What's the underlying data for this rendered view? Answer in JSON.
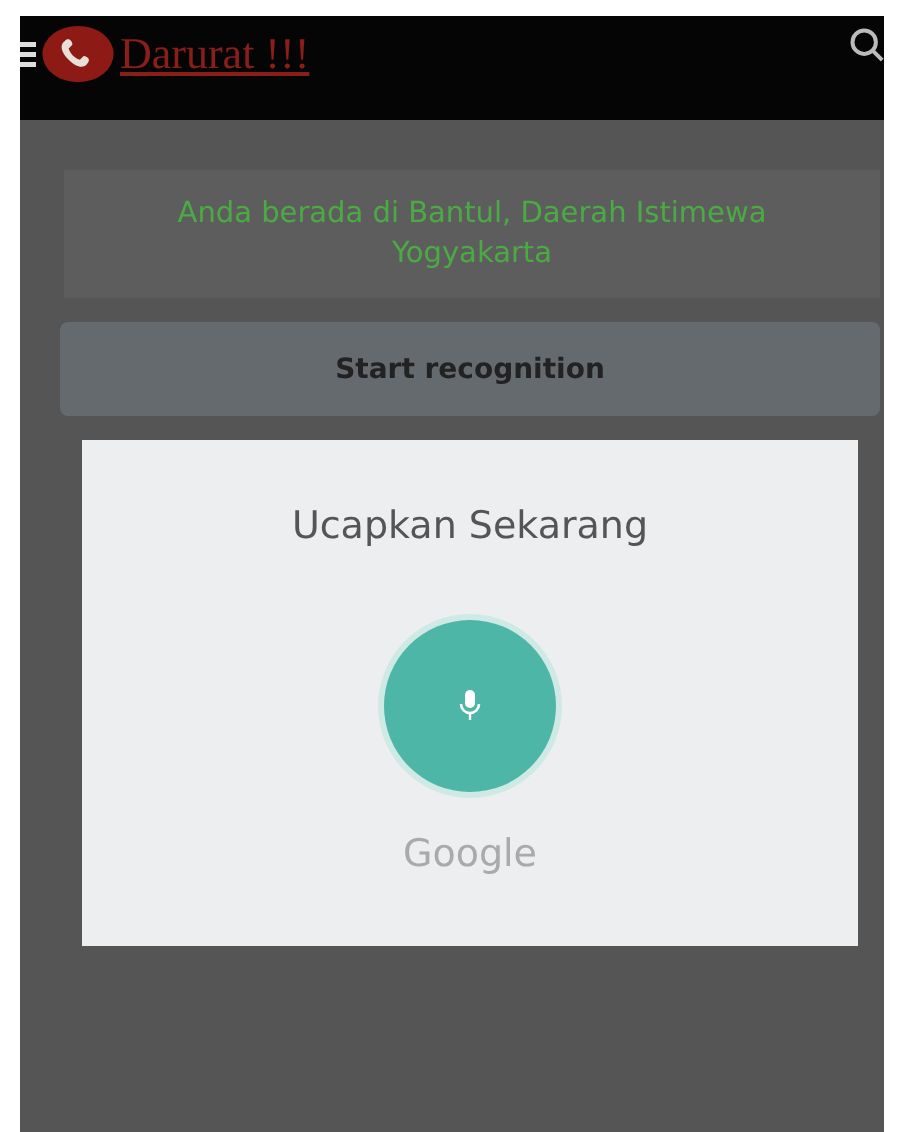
{
  "header": {
    "title": "Darurat !!!"
  },
  "location": {
    "text": "Anda berada di Bantul, Daerah Istimewa Yogyakarta"
  },
  "button": {
    "label": "Start recognition"
  },
  "dialog": {
    "prompt": "Ucapkan Sekarang",
    "provider": "Google"
  }
}
